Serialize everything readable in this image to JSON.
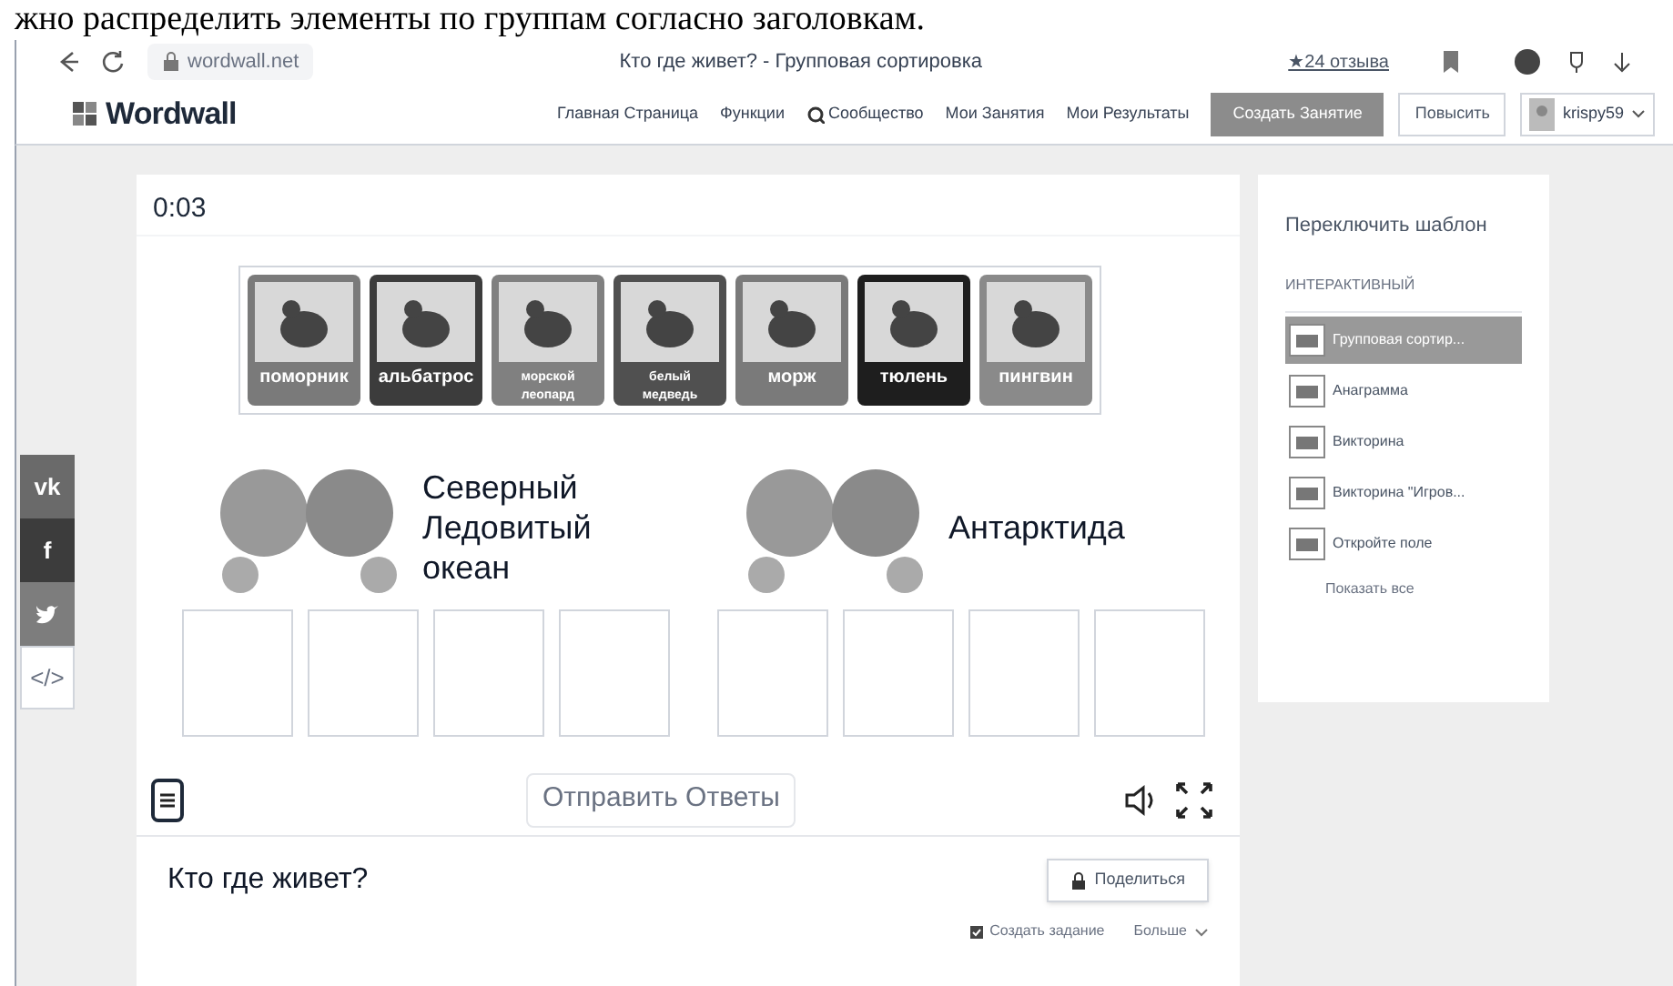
{
  "document_text": "жно распределить элементы по группам согласно заголовкам.",
  "browser": {
    "url": "wordwall.net",
    "title": "Кто где живет? - Групповая сортировка",
    "reviews": "★24 отзыва"
  },
  "nav": {
    "logo": "Wordwall",
    "links": [
      "Главная Страница",
      "Функции",
      "Сообщество",
      "Мои Занятия",
      "Мои Результаты"
    ],
    "create_button": "Создать Занятие",
    "upgrade_button": "Повысить",
    "user": "krispy59"
  },
  "share_bar": [
    {
      "kind": "vk",
      "label": "vk"
    },
    {
      "kind": "facebook",
      "label": "f"
    },
    {
      "kind": "twitter"
    },
    {
      "kind": "embed",
      "label": "</>"
    }
  ],
  "game": {
    "timer": "0:03",
    "cards": [
      {
        "label": "поморник",
        "color": "#7a7a7a"
      },
      {
        "label": "альбатрос",
        "color": "#3c3c3c"
      },
      {
        "label": "морской леопард",
        "color": "#808080"
      },
      {
        "label": "белый медведь",
        "color": "#505050"
      },
      {
        "label": "морж",
        "color": "#7a7a7a"
      },
      {
        "label": "тюлень",
        "color": "#1e1e1e"
      },
      {
        "label": "пингвин",
        "color": "#8a8a8a"
      }
    ],
    "groups": [
      {
        "title": "Северный Ледовитый океан"
      },
      {
        "title": "Антарктида"
      }
    ],
    "submit_button": "Отправить Ответы"
  },
  "activity": {
    "title": "Кто где живет?",
    "share_button": "Поделиться",
    "create_task": "Создать задание",
    "more": "Больше"
  },
  "templates": {
    "title": "Переключить шаблон",
    "section": "ИНТЕРАКТИВНЫЙ",
    "items": [
      {
        "label": "Групповая сортир...",
        "selected": true
      },
      {
        "label": "Анаграмма",
        "selected": false
      },
      {
        "label": "Викторина",
        "selected": false
      },
      {
        "label": "Викторина \"Игров...",
        "selected": false
      },
      {
        "label": "Откройте поле",
        "selected": false
      }
    ],
    "show_all": "Показать все"
  }
}
